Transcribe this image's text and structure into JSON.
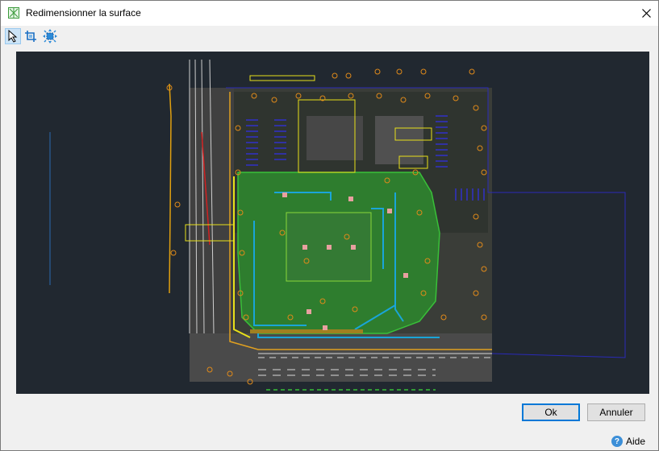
{
  "window": {
    "title": "Redimensionner la surface",
    "close_glyph": "✕"
  },
  "toolbar": {
    "tools": [
      {
        "icon": "select-arrow-icon"
      },
      {
        "icon": "crop-extents-icon"
      },
      {
        "icon": "resize-handles-icon"
      }
    ]
  },
  "buttons": {
    "ok_label": "Ok",
    "cancel_label": "Annuler"
  },
  "help": {
    "glyph": "?",
    "label": "Aide"
  },
  "colors": {
    "canvas_bg": "#212830",
    "accent": "#0078d7",
    "drawing_yellow": "#e8e01a",
    "drawing_orange": "#e08a1a",
    "drawing_green": "#2f9a3a",
    "drawing_cyan": "#1aa5d8",
    "drawing_blue": "#2a2ab8"
  }
}
